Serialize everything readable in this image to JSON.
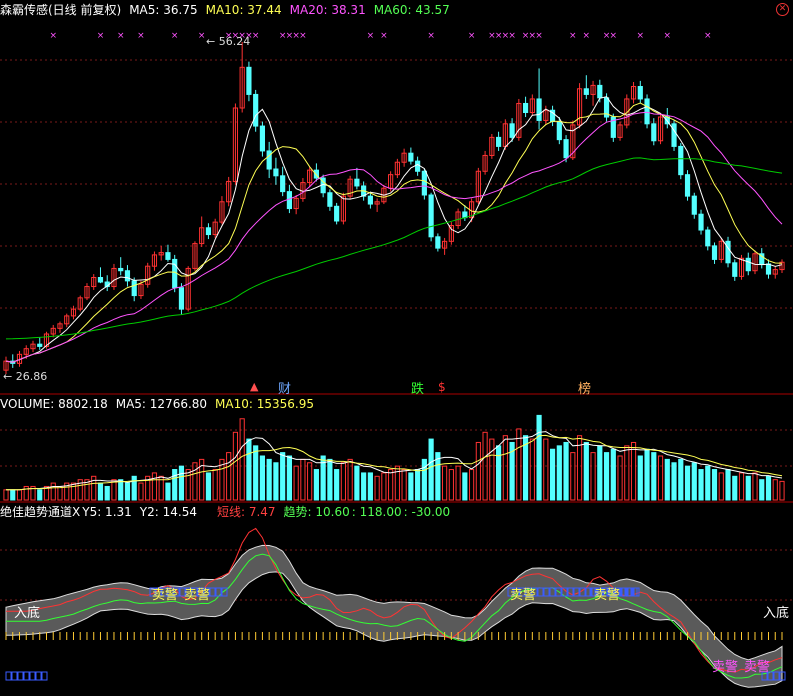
{
  "main_header": {
    "title": "森霸传感(日线 前复权)",
    "ma5": "MA5: 36.75",
    "ma10": "MA10: 37.44",
    "ma20": "MA20: 38.31",
    "ma60": "MA60: 43.57"
  },
  "annotations": {
    "high_label": "56.24",
    "low_label": "26.86",
    "event_cai": "财",
    "event_die": "跌",
    "event_dollar": "$",
    "event_bang": "榜"
  },
  "volume_header": {
    "volume": "VOLUME: 8802.18",
    "ma5": "MA5: 12766.80",
    "ma10": "MA10: 15356.95"
  },
  "indicator_header": {
    "name": "绝佳趋势通道X",
    "y5": "Y5: 1.31",
    "y2": "Y2: 14.54",
    "short_line": "短线: 7.47",
    "trend": "趋势: 10.60",
    "v1": ": 118.00",
    "v2": ": -30.00"
  },
  "indicator_labels": {
    "entry_left": "入底",
    "entry_right": "入底",
    "sell1": "卖警",
    "sell2": "卖警",
    "sell3": "卖警",
    "sell4": "卖警",
    "sell5": "卖警",
    "sell6": "卖警"
  },
  "colors": {
    "up": "#ff3232",
    "down": "#54ffff",
    "ma5": "#ffffff",
    "ma10": "#ffff54",
    "ma20": "#ff54ff",
    "ma60": "#00cc00"
  },
  "chart_data": {
    "type": "candlestick",
    "price_range": [
      26.86,
      56.24
    ],
    "high": 56.24,
    "low": 26.86,
    "candles": [
      [
        27.2,
        28.4,
        26.86,
        28.0
      ],
      [
        28.0,
        28.6,
        27.4,
        27.8
      ],
      [
        27.8,
        28.9,
        27.5,
        28.6
      ],
      [
        28.6,
        29.4,
        28.2,
        29.1
      ],
      [
        29.1,
        29.8,
        28.8,
        29.5
      ],
      [
        29.5,
        30.1,
        29.0,
        29.3
      ],
      [
        29.3,
        30.6,
        29.1,
        30.4
      ],
      [
        30.4,
        31.2,
        30.1,
        30.9
      ],
      [
        30.9,
        31.5,
        30.5,
        31.3
      ],
      [
        31.3,
        32.2,
        31.0,
        32.0
      ],
      [
        32.0,
        32.9,
        31.7,
        32.6
      ],
      [
        32.6,
        33.8,
        32.4,
        33.6
      ],
      [
        33.6,
        34.9,
        33.4,
        34.6
      ],
      [
        34.6,
        35.7,
        34.3,
        35.4
      ],
      [
        35.4,
        36.3,
        34.9,
        35.0
      ],
      [
        35.0,
        35.6,
        34.2,
        34.6
      ],
      [
        34.6,
        36.6,
        34.3,
        36.2
      ],
      [
        36.2,
        37.2,
        35.6,
        36.0
      ],
      [
        36.0,
        36.5,
        34.6,
        35.1
      ],
      [
        35.1,
        35.4,
        33.3,
        33.8
      ],
      [
        33.8,
        35.1,
        33.5,
        34.8
      ],
      [
        34.8,
        36.7,
        34.5,
        36.4
      ],
      [
        36.4,
        37.7,
        36.0,
        37.4
      ],
      [
        37.4,
        38.2,
        36.9,
        37.6
      ],
      [
        37.6,
        38.3,
        36.8,
        37.0
      ],
      [
        37.0,
        37.4,
        34.1,
        34.5
      ],
      [
        34.5,
        34.9,
        32.1,
        32.6
      ],
      [
        32.6,
        36.4,
        32.4,
        36.2
      ],
      [
        36.2,
        38.6,
        36.0,
        38.4
      ],
      [
        38.4,
        40.8,
        38.1,
        39.8
      ],
      [
        39.8,
        40.2,
        38.8,
        39.2
      ],
      [
        39.2,
        40.6,
        38.9,
        40.3
      ],
      [
        40.3,
        42.6,
        40.1,
        42.1
      ],
      [
        42.1,
        44.3,
        41.7,
        43.9
      ],
      [
        43.9,
        50.8,
        43.6,
        50.4
      ],
      [
        50.4,
        56.24,
        50.0,
        54.0
      ],
      [
        54.0,
        54.5,
        51.0,
        51.6
      ],
      [
        51.6,
        52.0,
        48.3,
        48.8
      ],
      [
        48.8,
        49.2,
        46.1,
        46.6
      ],
      [
        46.6,
        47.4,
        44.2,
        45.0
      ],
      [
        45.0,
        46.0,
        43.6,
        44.4
      ],
      [
        44.4,
        45.2,
        42.6,
        43.0
      ],
      [
        43.0,
        43.6,
        41.1,
        41.5
      ],
      [
        41.5,
        42.7,
        41.0,
        42.4
      ],
      [
        42.4,
        44.2,
        42.1,
        43.8
      ],
      [
        43.8,
        45.2,
        43.4,
        44.9
      ],
      [
        44.9,
        45.5,
        43.9,
        44.2
      ],
      [
        44.2,
        44.5,
        42.5,
        42.9
      ],
      [
        42.9,
        43.2,
        41.3,
        41.7
      ],
      [
        41.7,
        42.0,
        40.1,
        40.4
      ],
      [
        40.4,
        42.9,
        40.1,
        42.6
      ],
      [
        42.6,
        44.4,
        42.3,
        44.1
      ],
      [
        44.1,
        45.1,
        43.2,
        43.5
      ],
      [
        43.5,
        43.9,
        42.2,
        42.6
      ],
      [
        42.6,
        43.0,
        41.5,
        41.9
      ],
      [
        41.9,
        42.4,
        41.2,
        42.1
      ],
      [
        42.1,
        43.6,
        41.9,
        43.3
      ],
      [
        43.3,
        44.8,
        43.0,
        44.5
      ],
      [
        44.5,
        45.9,
        44.2,
        45.6
      ],
      [
        45.6,
        46.8,
        45.2,
        46.4
      ],
      [
        46.4,
        46.9,
        45.4,
        45.7
      ],
      [
        45.7,
        46.1,
        44.4,
        44.8
      ],
      [
        44.8,
        45.0,
        42.3,
        42.7
      ],
      [
        42.7,
        42.9,
        38.6,
        39.0
      ],
      [
        39.0,
        39.3,
        37.7,
        38.0
      ],
      [
        38.0,
        38.9,
        37.4,
        38.6
      ],
      [
        38.6,
        40.3,
        38.3,
        40.0
      ],
      [
        40.0,
        41.5,
        39.7,
        41.2
      ],
      [
        41.2,
        41.8,
        40.4,
        40.7
      ],
      [
        40.7,
        42.4,
        40.3,
        42.1
      ],
      [
        42.1,
        45.1,
        41.9,
        44.8
      ],
      [
        44.8,
        46.6,
        44.5,
        46.2
      ],
      [
        46.2,
        48.1,
        45.9,
        47.8
      ],
      [
        47.8,
        48.3,
        46.6,
        47.0
      ],
      [
        47.0,
        49.4,
        46.7,
        49.0
      ],
      [
        49.0,
        49.5,
        47.4,
        47.8
      ],
      [
        47.8,
        51.2,
        47.5,
        50.8
      ],
      [
        50.8,
        51.4,
        49.6,
        50.0
      ],
      [
        50.0,
        51.6,
        49.7,
        51.2
      ],
      [
        51.2,
        53.9,
        48.5,
        49.3
      ],
      [
        49.3,
        50.6,
        48.9,
        50.2
      ],
      [
        50.2,
        50.6,
        48.8,
        49.2
      ],
      [
        49.2,
        49.6,
        47.2,
        47.6
      ],
      [
        47.6,
        48.0,
        45.6,
        46.0
      ],
      [
        46.0,
        49.3,
        45.8,
        48.9
      ],
      [
        48.9,
        52.6,
        48.6,
        52.1
      ],
      [
        52.1,
        53.3,
        51.2,
        51.6
      ],
      [
        51.6,
        52.8,
        50.6,
        52.4
      ],
      [
        52.4,
        52.9,
        50.9,
        51.3
      ],
      [
        51.3,
        51.7,
        49.2,
        49.6
      ],
      [
        49.6,
        49.9,
        47.4,
        47.8
      ],
      [
        47.8,
        49.2,
        47.5,
        48.9
      ],
      [
        48.9,
        51.6,
        48.6,
        51.2
      ],
      [
        51.2,
        52.7,
        50.8,
        52.3
      ],
      [
        52.3,
        52.8,
        50.8,
        51.2
      ],
      [
        51.2,
        51.6,
        48.6,
        49.0
      ],
      [
        49.0,
        49.5,
        47.1,
        47.5
      ],
      [
        47.5,
        49.9,
        47.2,
        49.6
      ],
      [
        49.6,
        50.4,
        48.6,
        49.0
      ],
      [
        49.0,
        49.3,
        46.6,
        47.0
      ],
      [
        47.0,
        47.3,
        44.1,
        44.5
      ],
      [
        44.5,
        44.9,
        42.2,
        42.6
      ],
      [
        42.6,
        42.9,
        40.6,
        41.0
      ],
      [
        41.0,
        41.4,
        39.2,
        39.6
      ],
      [
        39.6,
        39.9,
        37.8,
        38.2
      ],
      [
        38.2,
        38.5,
        36.6,
        37.0
      ],
      [
        37.0,
        38.9,
        36.7,
        38.6
      ],
      [
        38.6,
        39.0,
        36.3,
        36.7
      ],
      [
        36.7,
        37.0,
        35.1,
        35.5
      ],
      [
        35.5,
        37.4,
        35.2,
        37.1
      ],
      [
        37.1,
        37.6,
        35.6,
        36.0
      ],
      [
        36.0,
        37.8,
        35.7,
        37.5
      ],
      [
        37.5,
        38.0,
        36.2,
        36.6
      ],
      [
        36.6,
        37.0,
        35.3,
        35.7
      ],
      [
        35.7,
        36.4,
        35.3,
        36.1
      ],
      [
        36.1,
        37.0,
        35.8,
        36.75
      ]
    ],
    "volume": [
      3,
      3,
      3,
      4,
      4,
      3,
      4,
      5,
      4,
      5,
      5,
      6,
      6,
      7,
      5,
      4,
      6,
      6,
      5,
      7,
      5,
      7,
      8,
      7,
      5,
      9,
      10,
      9,
      11,
      12,
      8,
      9,
      12,
      14,
      20,
      24,
      18,
      16,
      13,
      12,
      11,
      14,
      13,
      10,
      12,
      11,
      9,
      13,
      12,
      9,
      11,
      12,
      10,
      8,
      8,
      7,
      8,
      9,
      10,
      9,
      8,
      9,
      12,
      18,
      14,
      10,
      9,
      10,
      8,
      9,
      17,
      20,
      18,
      16,
      19,
      17,
      21,
      19,
      18,
      25,
      18,
      15,
      16,
      17,
      14,
      19,
      17,
      14,
      16,
      14,
      15,
      13,
      16,
      17,
      13,
      15,
      14,
      13,
      12,
      11,
      12,
      10,
      11,
      9,
      10,
      9,
      8,
      9,
      7,
      8,
      7,
      8,
      6,
      7,
      6,
      5.5
    ],
    "series": [
      {
        "name": "MA5"
      },
      {
        "name": "MA10"
      },
      {
        "name": "MA20"
      },
      {
        "name": "MA60"
      }
    ]
  }
}
